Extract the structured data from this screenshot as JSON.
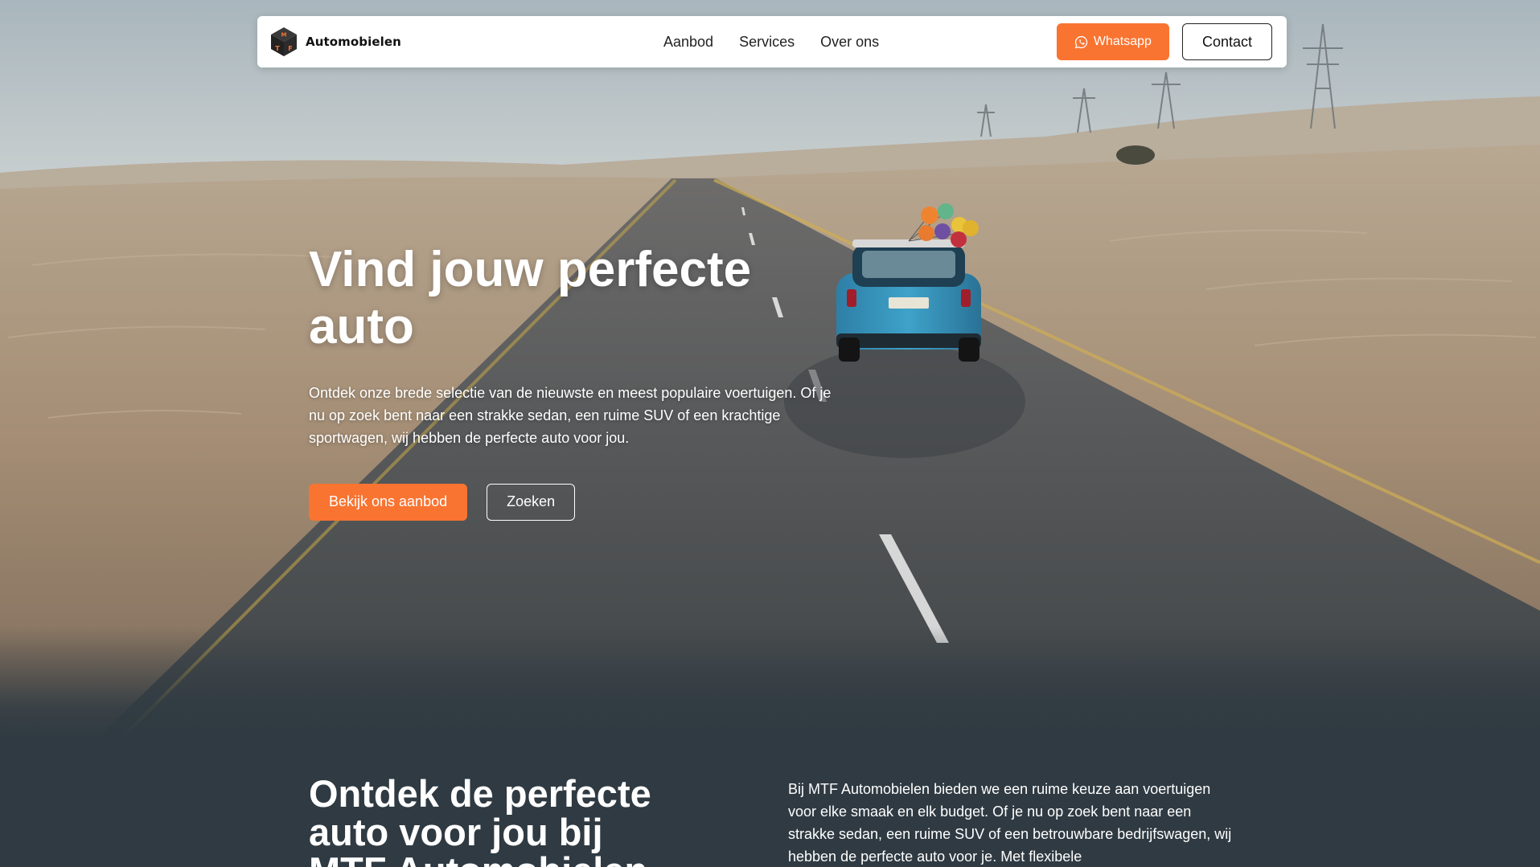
{
  "navbar": {
    "brand_name": "Automobielen",
    "brand_logo_letters": "MTF",
    "links": [
      "Aanbod",
      "Services",
      "Over ons"
    ],
    "whatsapp_label": "Whatsapp",
    "contact_label": "Contact"
  },
  "hero": {
    "title": "Vind jouw perfecte auto",
    "text": "Ontdek onze brede selectie van de nieuwste en meest populaire voertuigen. Of je nu op zoek bent naar een strakke sedan, een ruime SUV of een krachtige sportwagen, wij hebben de perfecte auto voor jou.",
    "primary_button": "Bekijk ons aanbod",
    "secondary_button": "Zoeken",
    "background": "desert-road-with-car-and-balloons"
  },
  "section_two": {
    "title": "Ontdek de perfecte auto voor jou bij MTF Automobielen",
    "text": "Bij MTF Automobielen bieden we een ruime keuze aan voertuigen voor elke smaak en elk budget. Of je nu op zoek bent naar een strakke sedan, een ruime SUV of een betrouwbare bedrijfswagen, wij hebben de perfecte auto voor je. Met flexibele financieringsmogelijkheden en"
  },
  "colors": {
    "accent": "#f97431",
    "section_bg": "#2f3a42",
    "navbar_bg": "#ffffff"
  },
  "icons": {
    "whatsapp": "whatsapp-icon",
    "logo": "cube-logo-icon"
  }
}
